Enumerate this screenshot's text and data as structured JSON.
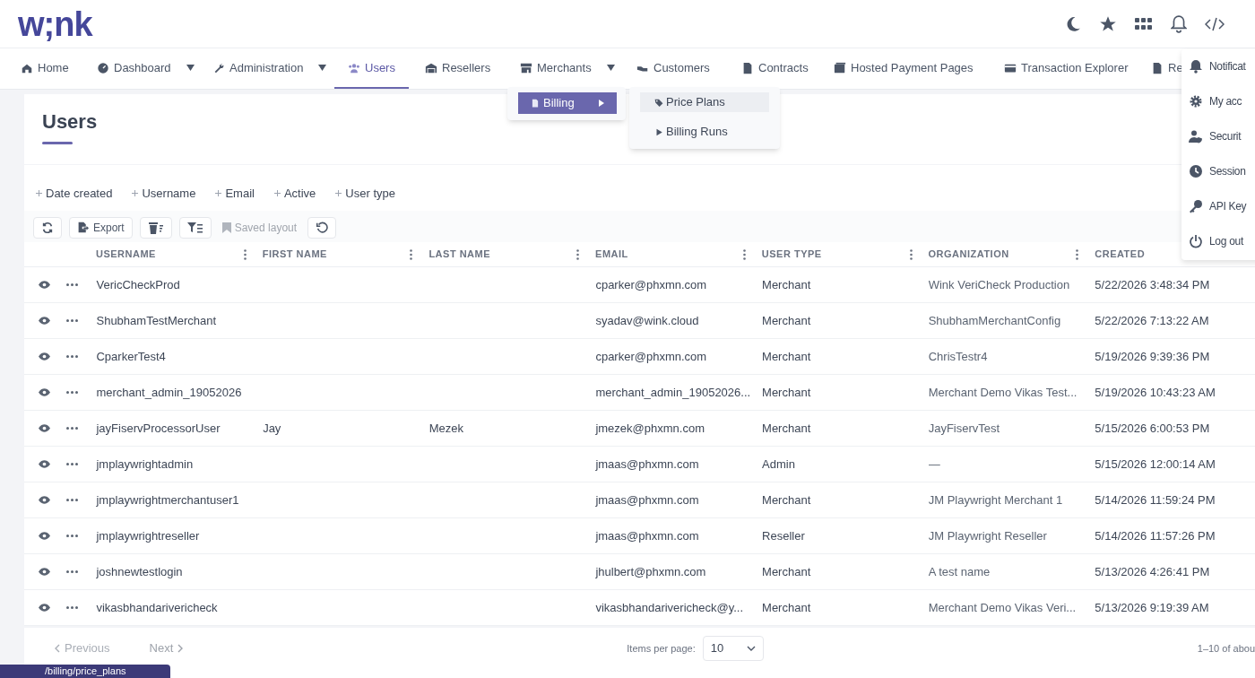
{
  "logo": {
    "text": "w;nk"
  },
  "nav": [
    {
      "label": "Home",
      "caret": false,
      "selected": false
    },
    {
      "label": "Dashboard",
      "caret": true,
      "selected": false
    },
    {
      "label": "Administration",
      "caret": true,
      "selected": false
    },
    {
      "label": "Users",
      "caret": false,
      "selected": true
    },
    {
      "label": "Resellers",
      "caret": false,
      "selected": false
    },
    {
      "label": "Merchants",
      "caret": true,
      "selected": false
    },
    {
      "label": "Customers",
      "caret": false,
      "selected": false
    },
    {
      "label": "Contracts",
      "caret": false,
      "selected": false
    },
    {
      "label": "Hosted Payment Pages",
      "caret": false,
      "selected": false
    },
    {
      "label": "Transaction Explorer",
      "caret": false,
      "selected": false
    },
    {
      "label": "Re",
      "caret": false,
      "selected": false
    }
  ],
  "merchants_menu": [
    {
      "label": "Billing",
      "selected": true,
      "submenu": true
    }
  ],
  "billing_submenu": [
    {
      "label": "Price Plans",
      "selected": true
    },
    {
      "label": "Billing Runs",
      "selected": false
    }
  ],
  "user_menu": [
    {
      "label": "Notificat"
    },
    {
      "label": "My acc"
    },
    {
      "label": "Securit"
    },
    {
      "label": "Session"
    },
    {
      "label": "API Key"
    },
    {
      "label": "Log out"
    }
  ],
  "page_title": "Users",
  "filters": [
    "Date created",
    "Username",
    "Email",
    "Active",
    "User type"
  ],
  "toolbar": {
    "export": "Export",
    "saved_layout": "Saved layout"
  },
  "table": {
    "columns": [
      "USERNAME",
      "FIRST NAME",
      "LAST NAME",
      "EMAIL",
      "USER TYPE",
      "ORGANIZATION",
      "CREATED"
    ],
    "rows": [
      [
        "VericCheckProd",
        "",
        "",
        "cparker@phxmn.com",
        "Merchant",
        "Wink VeriCheck Production",
        "5/22/2026 3:48:34 PM"
      ],
      [
        "ShubhamTestMerchant",
        "",
        "",
        "syadav@wink.cloud",
        "Merchant",
        "ShubhamMerchantConfig",
        "5/22/2026 7:13:22 AM"
      ],
      [
        "CparkerTest4",
        "",
        "",
        "cparker@phxmn.com",
        "Merchant",
        "ChrisTestr4",
        "5/19/2026 9:39:36 PM"
      ],
      [
        "merchant_admin_19052026",
        "",
        "",
        "merchant_admin_19052026...",
        "Merchant",
        "Merchant Demo Vikas Test...",
        "5/19/2026 10:43:23 AM"
      ],
      [
        "jayFiservProcessorUser",
        "Jay",
        "Mezek",
        "jmezek@phxmn.com",
        "Merchant",
        "JayFiservTest",
        "5/15/2026 6:00:53 PM"
      ],
      [
        "jmplaywrightadmin",
        "",
        "",
        "jmaas@phxmn.com",
        "Admin",
        "—",
        "5/15/2026 12:00:14 AM"
      ],
      [
        "jmplaywrightmerchantuser1",
        "",
        "",
        "jmaas@phxmn.com",
        "Merchant",
        "JM Playwright Merchant 1",
        "5/14/2026 11:59:24 PM"
      ],
      [
        "jmplaywrightreseller",
        "",
        "",
        "jmaas@phxmn.com",
        "Reseller",
        "JM Playwright Reseller",
        "5/14/2026 11:57:26 PM"
      ],
      [
        "joshnewtestlogin",
        "",
        "",
        "jhulbert@phxmn.com",
        "Merchant",
        "A test name",
        "5/13/2026 4:26:41 PM"
      ],
      [
        "vikasbhandarivericheck",
        "",
        "",
        "vikasbhandarivericheck@y...",
        "Merchant",
        "Merchant Demo Vikas Veri...",
        "5/13/2026 9:19:39 AM"
      ]
    ]
  },
  "pagination": {
    "previous": "Previous",
    "next": "Next",
    "items_per_page_label": "Items per page:",
    "items_per_page": "10",
    "range": "1–10 of abou"
  },
  "status_url": "/billing/price_plans"
}
